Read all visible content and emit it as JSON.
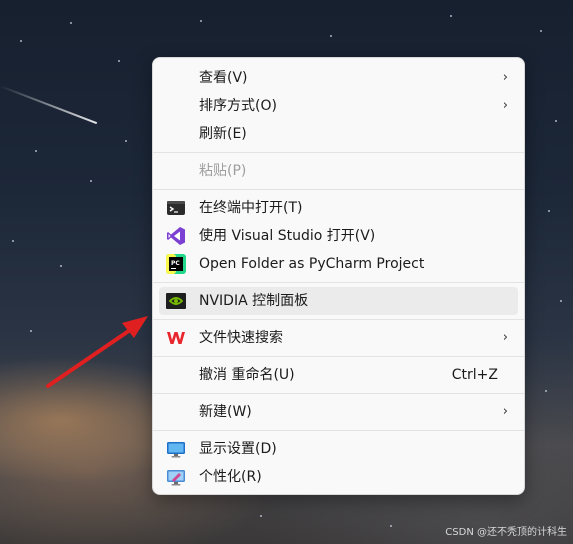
{
  "menu": {
    "items": [
      {
        "label": "查看(V)",
        "arrow": "›"
      },
      {
        "label": "排序方式(O)",
        "arrow": "›"
      },
      {
        "label": "刷新(E)"
      },
      {
        "label": "粘贴(P)"
      },
      {
        "label": "在终端中打开(T)",
        "icon": "terminal-icon"
      },
      {
        "label": "使用 Visual Studio 打开(V)",
        "icon": "visual-studio-icon"
      },
      {
        "label": "Open Folder as PyCharm Project",
        "icon": "pycharm-icon"
      },
      {
        "label": "NVIDIA 控制面板",
        "icon": "nvidia-icon"
      },
      {
        "label": "文件快速搜索",
        "arrow": "›",
        "icon": "wps-icon"
      },
      {
        "label": "撤消 重命名(U)",
        "shortcut": "Ctrl+Z"
      },
      {
        "label": "新建(W)",
        "arrow": "›"
      },
      {
        "label": "显示设置(D)",
        "icon": "display-settings-icon"
      },
      {
        "label": "个性化(R)",
        "icon": "personalize-icon"
      }
    ]
  },
  "watermark": "CSDN @还不秃顶的计科生",
  "colors": {
    "menu_bg": "#f9f9f9",
    "hover_bg": "#ebebeb",
    "disabled_text": "#9e9e9e",
    "annotation_arrow": "#e02020"
  }
}
